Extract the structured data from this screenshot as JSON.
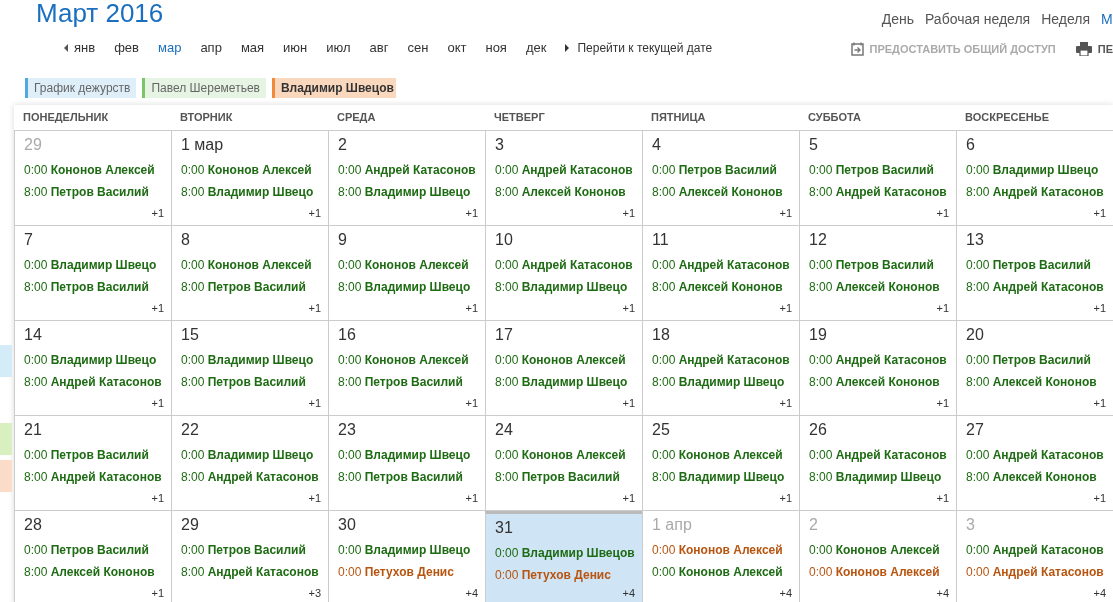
{
  "title": "Март 2016",
  "views": [
    {
      "label": "День",
      "selected": false
    },
    {
      "label": "Рабочая неделя",
      "selected": false
    },
    {
      "label": "Неделя",
      "selected": false
    },
    {
      "label": "М",
      "selected": true
    }
  ],
  "months": [
    {
      "label": "янв",
      "selected": false
    },
    {
      "label": "фев",
      "selected": false
    },
    {
      "label": "мар",
      "selected": true
    },
    {
      "label": "апр",
      "selected": false
    },
    {
      "label": "мая",
      "selected": false
    },
    {
      "label": "июн",
      "selected": false
    },
    {
      "label": "июл",
      "selected": false
    },
    {
      "label": "авг",
      "selected": false
    },
    {
      "label": "сен",
      "selected": false
    },
    {
      "label": "окт",
      "selected": false
    },
    {
      "label": "ноя",
      "selected": false
    },
    {
      "label": "дек",
      "selected": false
    }
  ],
  "today_link": "Перейти к текущей дате",
  "actions": [
    {
      "kind": "share",
      "label": "ПРЕДОСТАВИТЬ ОБЩИЙ ДОСТУП"
    },
    {
      "kind": "print",
      "label": "ПЕ"
    }
  ],
  "calendars": [
    {
      "label": "График дежурств",
      "color": "#4fa8e0",
      "selected": false
    },
    {
      "label": "Павел Шереметьев",
      "color": "#7cc46a",
      "selected": false
    },
    {
      "label": "Владимир Швецов",
      "color": "#f08a3c",
      "selected": true
    }
  ],
  "weekdays": [
    "ПОНЕДЕЛЬНИК",
    "ВТОРНИК",
    "СРЕДА",
    "ЧЕТВЕРГ",
    "ПЯТНИЦА",
    "СУББОТА",
    "ВОСКРЕСЕНЬЕ"
  ],
  "weeks": [
    [
      {
        "date": "29",
        "muted": true,
        "selected": false,
        "more": "+1",
        "events": [
          {
            "time": "0:00",
            "name": "Кононов Алексей",
            "color": "#1d6b12"
          },
          {
            "time": "8:00",
            "name": "Петров Василий",
            "color": "#1d6b12"
          }
        ]
      },
      {
        "date": "1 мар",
        "muted": false,
        "selected": false,
        "more": "+1",
        "events": [
          {
            "time": "0:00",
            "name": "Кононов Алексей",
            "color": "#1d6b12"
          },
          {
            "time": "8:00",
            "name": "Владимир Швецо",
            "color": "#1d6b12"
          }
        ]
      },
      {
        "date": "2",
        "muted": false,
        "selected": false,
        "more": "+1",
        "events": [
          {
            "time": "0:00",
            "name": "Андрей Катасонов",
            "color": "#1d6b12"
          },
          {
            "time": "8:00",
            "name": "Владимир Швецо",
            "color": "#1d6b12"
          }
        ]
      },
      {
        "date": "3",
        "muted": false,
        "selected": false,
        "more": "+1",
        "events": [
          {
            "time": "0:00",
            "name": "Андрей Катасонов",
            "color": "#1d6b12"
          },
          {
            "time": "8:00",
            "name": "Алексей Кононов",
            "color": "#1d6b12"
          }
        ]
      },
      {
        "date": "4",
        "muted": false,
        "selected": false,
        "more": "+1",
        "events": [
          {
            "time": "0:00",
            "name": "Петров Василий",
            "color": "#1d6b12"
          },
          {
            "time": "8:00",
            "name": "Алексей Кононов",
            "color": "#1d6b12"
          }
        ]
      },
      {
        "date": "5",
        "muted": false,
        "selected": false,
        "more": "+1",
        "events": [
          {
            "time": "0:00",
            "name": "Петров Василий",
            "color": "#1d6b12"
          },
          {
            "time": "8:00",
            "name": "Андрей Катасонов",
            "color": "#1d6b12"
          }
        ]
      },
      {
        "date": "6",
        "muted": false,
        "selected": false,
        "more": "+1",
        "events": [
          {
            "time": "0:00",
            "name": "Владимир Швецо",
            "color": "#1d6b12"
          },
          {
            "time": "8:00",
            "name": "Андрей Катасонов",
            "color": "#1d6b12"
          }
        ]
      }
    ],
    [
      {
        "date": "7",
        "muted": false,
        "selected": false,
        "more": "+1",
        "events": [
          {
            "time": "0:00",
            "name": "Владимир Швецо",
            "color": "#1d6b12"
          },
          {
            "time": "8:00",
            "name": "Петров Василий",
            "color": "#1d6b12"
          }
        ]
      },
      {
        "date": "8",
        "muted": false,
        "selected": false,
        "more": "+1",
        "events": [
          {
            "time": "0:00",
            "name": "Кононов Алексей",
            "color": "#1d6b12"
          },
          {
            "time": "8:00",
            "name": "Петров Василий",
            "color": "#1d6b12"
          }
        ]
      },
      {
        "date": "9",
        "muted": false,
        "selected": false,
        "more": "+1",
        "events": [
          {
            "time": "0:00",
            "name": "Кононов Алексей",
            "color": "#1d6b12"
          },
          {
            "time": "8:00",
            "name": "Владимир Швецо",
            "color": "#1d6b12"
          }
        ]
      },
      {
        "date": "10",
        "muted": false,
        "selected": false,
        "more": "+1",
        "events": [
          {
            "time": "0:00",
            "name": "Андрей Катасонов",
            "color": "#1d6b12"
          },
          {
            "time": "8:00",
            "name": "Владимир Швецо",
            "color": "#1d6b12"
          }
        ]
      },
      {
        "date": "11",
        "muted": false,
        "selected": false,
        "more": "+1",
        "events": [
          {
            "time": "0:00",
            "name": "Андрей Катасонов",
            "color": "#1d6b12"
          },
          {
            "time": "8:00",
            "name": "Алексей Кононов",
            "color": "#1d6b12"
          }
        ]
      },
      {
        "date": "12",
        "muted": false,
        "selected": false,
        "more": "+1",
        "events": [
          {
            "time": "0:00",
            "name": "Петров Василий",
            "color": "#1d6b12"
          },
          {
            "time": "8:00",
            "name": "Алексей Кононов",
            "color": "#1d6b12"
          }
        ]
      },
      {
        "date": "13",
        "muted": false,
        "selected": false,
        "more": "+1",
        "events": [
          {
            "time": "0:00",
            "name": "Петров Василий",
            "color": "#1d6b12"
          },
          {
            "time": "8:00",
            "name": "Андрей Катасонов",
            "color": "#1d6b12"
          }
        ]
      }
    ],
    [
      {
        "date": "14",
        "muted": false,
        "selected": false,
        "more": "+1",
        "events": [
          {
            "time": "0:00",
            "name": "Владимир Швецо",
            "color": "#1d6b12"
          },
          {
            "time": "8:00",
            "name": "Андрей Катасонов",
            "color": "#1d6b12"
          }
        ]
      },
      {
        "date": "15",
        "muted": false,
        "selected": false,
        "more": "+1",
        "events": [
          {
            "time": "0:00",
            "name": "Владимир Швецо",
            "color": "#1d6b12"
          },
          {
            "time": "8:00",
            "name": "Петров Василий",
            "color": "#1d6b12"
          }
        ]
      },
      {
        "date": "16",
        "muted": false,
        "selected": false,
        "more": "+1",
        "events": [
          {
            "time": "0:00",
            "name": "Кононов Алексей",
            "color": "#1d6b12"
          },
          {
            "time": "8:00",
            "name": "Петров Василий",
            "color": "#1d6b12"
          }
        ]
      },
      {
        "date": "17",
        "muted": false,
        "selected": false,
        "more": "+1",
        "events": [
          {
            "time": "0:00",
            "name": "Кононов Алексей",
            "color": "#1d6b12"
          },
          {
            "time": "8:00",
            "name": "Владимир Швецо",
            "color": "#1d6b12"
          }
        ]
      },
      {
        "date": "18",
        "muted": false,
        "selected": false,
        "more": "+1",
        "events": [
          {
            "time": "0:00",
            "name": "Андрей Катасонов",
            "color": "#1d6b12"
          },
          {
            "time": "8:00",
            "name": "Владимир Швецо",
            "color": "#1d6b12"
          }
        ]
      },
      {
        "date": "19",
        "muted": false,
        "selected": false,
        "more": "+1",
        "events": [
          {
            "time": "0:00",
            "name": "Андрей Катасонов",
            "color": "#1d6b12"
          },
          {
            "time": "8:00",
            "name": "Алексей Кононов",
            "color": "#1d6b12"
          }
        ]
      },
      {
        "date": "20",
        "muted": false,
        "selected": false,
        "more": "+1",
        "events": [
          {
            "time": "0:00",
            "name": "Петров Василий",
            "color": "#1d6b12"
          },
          {
            "time": "8:00",
            "name": "Алексей Кононов",
            "color": "#1d6b12"
          }
        ]
      }
    ],
    [
      {
        "date": "21",
        "muted": false,
        "selected": false,
        "more": "+1",
        "events": [
          {
            "time": "0:00",
            "name": "Петров Василий",
            "color": "#1d6b12"
          },
          {
            "time": "8:00",
            "name": "Андрей Катасонов",
            "color": "#1d6b12"
          }
        ]
      },
      {
        "date": "22",
        "muted": false,
        "selected": false,
        "more": "+1",
        "events": [
          {
            "time": "0:00",
            "name": "Владимир Швецо",
            "color": "#1d6b12"
          },
          {
            "time": "8:00",
            "name": "Андрей Катасонов",
            "color": "#1d6b12"
          }
        ]
      },
      {
        "date": "23",
        "muted": false,
        "selected": false,
        "more": "+1",
        "events": [
          {
            "time": "0:00",
            "name": "Владимир Швецо",
            "color": "#1d6b12"
          },
          {
            "time": "8:00",
            "name": "Петров Василий",
            "color": "#1d6b12"
          }
        ]
      },
      {
        "date": "24",
        "muted": false,
        "selected": false,
        "more": "+1",
        "events": [
          {
            "time": "0:00",
            "name": "Кононов Алексей",
            "color": "#1d6b12"
          },
          {
            "time": "8:00",
            "name": "Петров Василий",
            "color": "#1d6b12"
          }
        ]
      },
      {
        "date": "25",
        "muted": false,
        "selected": false,
        "more": "+1",
        "events": [
          {
            "time": "0:00",
            "name": "Кононов Алексей",
            "color": "#1d6b12"
          },
          {
            "time": "8:00",
            "name": "Владимир Швецо",
            "color": "#1d6b12"
          }
        ]
      },
      {
        "date": "26",
        "muted": false,
        "selected": false,
        "more": "+1",
        "events": [
          {
            "time": "0:00",
            "name": "Андрей Катасонов",
            "color": "#1d6b12"
          },
          {
            "time": "8:00",
            "name": "Владимир Швецо",
            "color": "#1d6b12"
          }
        ]
      },
      {
        "date": "27",
        "muted": false,
        "selected": false,
        "more": "+1",
        "events": [
          {
            "time": "0:00",
            "name": "Андрей Катасонов",
            "color": "#1d6b12"
          },
          {
            "time": "8:00",
            "name": "Алексей Кононов",
            "color": "#1d6b12"
          }
        ]
      }
    ],
    [
      {
        "date": "28",
        "muted": false,
        "selected": false,
        "more": "+1",
        "events": [
          {
            "time": "0:00",
            "name": "Петров Василий",
            "color": "#1d6b12"
          },
          {
            "time": "8:00",
            "name": "Алексей Кононов",
            "color": "#1d6b12"
          }
        ]
      },
      {
        "date": "29",
        "muted": false,
        "selected": false,
        "more": "+3",
        "events": [
          {
            "time": "0:00",
            "name": "Петров Василий",
            "color": "#1d6b12"
          },
          {
            "time": "8:00",
            "name": "Андрей Катасонов",
            "color": "#1d6b12"
          }
        ]
      },
      {
        "date": "30",
        "muted": false,
        "selected": false,
        "more": "+4",
        "events": [
          {
            "time": "0:00",
            "name": "Владимир Швецо",
            "color": "#1d6b12"
          },
          {
            "time": "0:00",
            "name": "Петухов Денис",
            "color": "#b8540f"
          }
        ]
      },
      {
        "date": "31",
        "muted": false,
        "selected": true,
        "more": "+4",
        "events": [
          {
            "time": "0:00",
            "name": "Владимир Швецов",
            "color": "#1d6b12"
          },
          {
            "time": "0:00",
            "name": "Петухов Денис",
            "color": "#b8540f"
          }
        ]
      },
      {
        "date": "1 апр",
        "muted": true,
        "selected": false,
        "more": "+4",
        "events": [
          {
            "time": "0:00",
            "name": "Кононов Алексей",
            "color": "#b8540f"
          },
          {
            "time": "0:00",
            "name": "Кононов Алексей",
            "color": "#1d6b12"
          }
        ]
      },
      {
        "date": "2",
        "muted": true,
        "selected": false,
        "more": "+4",
        "events": [
          {
            "time": "0:00",
            "name": "Кононов Алексей",
            "color": "#1d6b12"
          },
          {
            "time": "0:00",
            "name": "Кононов Алексей",
            "color": "#b8540f"
          }
        ]
      },
      {
        "date": "3",
        "muted": true,
        "selected": false,
        "more": "+4",
        "events": [
          {
            "time": "0:00",
            "name": "Андрей Катасонов",
            "color": "#1d6b12"
          },
          {
            "time": "0:00",
            "name": "Андрей Катасонов",
            "color": "#b8540f"
          }
        ]
      }
    ]
  ]
}
